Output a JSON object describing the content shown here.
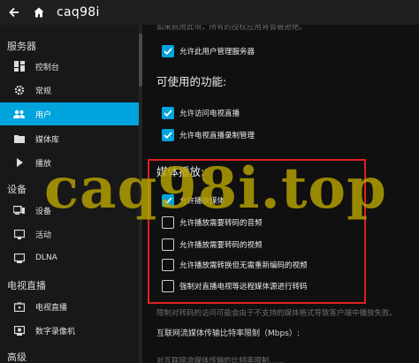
{
  "header": {
    "title": "caq98i",
    "icons": [
      "back-arrow-icon",
      "home-icon"
    ]
  },
  "sidebar": {
    "sections": [
      {
        "label": "服务器",
        "items": [
          {
            "label": "控制台",
            "icon": "dashboard-icon"
          },
          {
            "label": "常规",
            "icon": "gear-icon"
          },
          {
            "label": "用户",
            "icon": "people-icon",
            "active": true
          },
          {
            "label": "媒体库",
            "icon": "folder-icon"
          },
          {
            "label": "播放",
            "icon": "play-icon"
          }
        ]
      },
      {
        "label": "设备",
        "items": [
          {
            "label": "设备",
            "icon": "devices-icon"
          },
          {
            "label": "活动",
            "icon": "activity-icon"
          },
          {
            "label": "DLNA",
            "icon": "dlna-icon"
          }
        ]
      },
      {
        "label": "电视直播",
        "items": [
          {
            "label": "电视直播",
            "icon": "live-tv-icon"
          },
          {
            "label": "数字录像机",
            "icon": "dvr-icon"
          }
        ]
      },
      {
        "label": "高级",
        "items": []
      }
    ]
  },
  "main": {
    "top_faded": "如果启用此项，所有的授权应用将会被拒绝。",
    "allow_manage": {
      "label": "允许此用户管理服务器",
      "checked": true
    },
    "features": {
      "title": "可使用的功能:",
      "items": [
        {
          "label": "允许访问电视直播",
          "checked": true
        },
        {
          "label": "允许电视直播录制管理",
          "checked": true
        }
      ]
    },
    "media_playback": {
      "title": "媒体播放:",
      "items": [
        {
          "label": "允许播放媒体",
          "checked": true
        },
        {
          "label": "允许播放需要转码的音频",
          "checked": false
        },
        {
          "label": "允许播放需要转码的视频",
          "checked": false
        },
        {
          "label": "允许播放需转换但无需重新编码的视频",
          "checked": false
        },
        {
          "label": "强制对直播电视等远程媒体源进行转码",
          "checked": false
        }
      ]
    },
    "transcode_note": "限制对转码的访问可能会由于不支持的媒体格式导致客户端中播放失败。",
    "bitrate_label": "互联网流媒体传输比特率限制（Mbps）:",
    "bottom_faded": "对互联网流媒体传输的比特率限制……"
  },
  "watermark": "caq98i.top",
  "colors": {
    "accent": "#00a4dc",
    "highlight_box": "#e02020",
    "watermark": "#b8a400"
  }
}
